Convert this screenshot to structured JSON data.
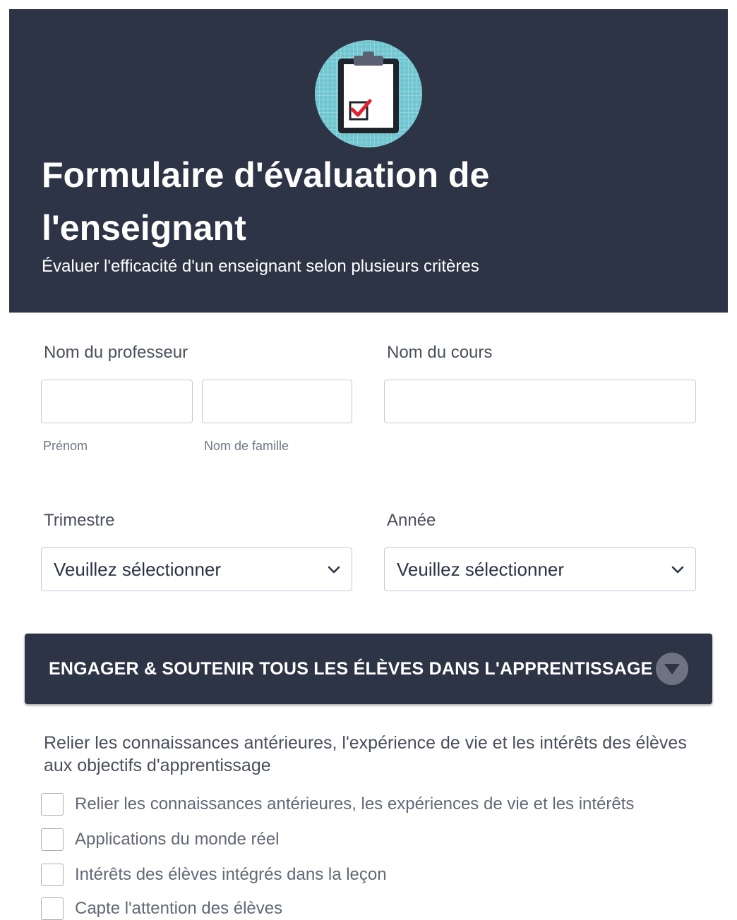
{
  "header": {
    "logo_icon": "clipboard-checkmark-icon",
    "title": "Formulaire d'évaluation de l'enseignant",
    "subtitle": "Évaluer l'efficacité d'un enseignant selon plusieurs critères"
  },
  "fields": {
    "teacher_label": "Nom du professeur",
    "first_name_sub": "Prénom",
    "last_name_sub": "Nom de famille",
    "course_label": "Nom du cours",
    "term_label": "Trimestre",
    "term_value": "Veuillez sélectionner",
    "year_label": "Année",
    "year_value": "Veuillez sélectionner"
  },
  "section": {
    "title": "ENGAGER & SOUTENIR TOUS LES ÉLÈVES DANS L'APPRENTISSAGE",
    "toggle_icon": "chevron-down-icon"
  },
  "question": {
    "text": "Relier les connaissances antérieures, l'expérience de vie et les intérêts des élèves aux objectifs d'apprentissage",
    "options": [
      "Relier les connaissances antérieures, les expériences de vie et les intérêts",
      "Applications du monde réel",
      "Intérêts des élèves intégrés dans la leçon",
      "Capte l'attention des élèves"
    ]
  },
  "colors": {
    "header_bg": "#2d3446",
    "logo_bg": "#6fc6d0",
    "check_red": "#e0232e"
  }
}
